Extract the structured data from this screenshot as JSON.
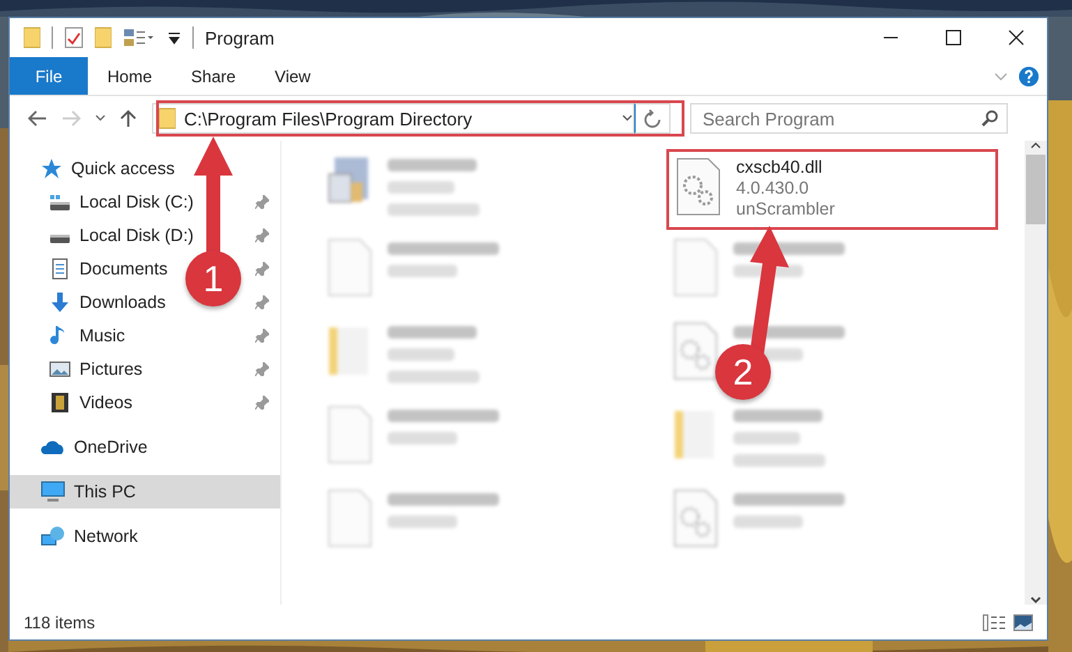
{
  "window": {
    "title": "Program"
  },
  "ribbon": {
    "file_tab": "File",
    "tabs": [
      "Home",
      "Share",
      "View"
    ]
  },
  "address_bar": {
    "path": "C:\\Program Files\\Program Directory"
  },
  "search": {
    "placeholder": "Search Program"
  },
  "sidebar": {
    "items": [
      {
        "label": "Quick access",
        "kind": "quick",
        "selected": false,
        "children": [
          {
            "label": "Local Disk (C:)",
            "kind": "disk-c",
            "pinned": true
          },
          {
            "label": "Local Disk (D:)",
            "kind": "disk",
            "pinned": true
          },
          {
            "label": "Documents",
            "kind": "documents",
            "pinned": true
          },
          {
            "label": "Downloads",
            "kind": "downloads",
            "pinned": true
          },
          {
            "label": "Music",
            "kind": "music",
            "pinned": true
          },
          {
            "label": "Pictures",
            "kind": "pictures",
            "pinned": true
          },
          {
            "label": "Videos",
            "kind": "videos",
            "pinned": true
          }
        ]
      },
      {
        "label": "OneDrive",
        "kind": "cloud",
        "selected": false
      },
      {
        "label": "This PC",
        "kind": "pc",
        "selected": true
      },
      {
        "label": "Network",
        "kind": "network",
        "selected": false
      }
    ]
  },
  "files": [
    {
      "kind": "app",
      "blurred": true,
      "highlighted": false
    },
    {
      "name": "cxscb40.dll",
      "lines": [
        "4.0.430.0",
        "unScrambler"
      ],
      "kind": "dll",
      "blurred": false,
      "highlighted": true
    },
    {
      "kind": "file",
      "blurred": true,
      "highlighted": false
    },
    {
      "kind": "file",
      "blurred": true,
      "highlighted": false
    },
    {
      "kind": "folder",
      "blurred": true,
      "highlighted": false
    },
    {
      "kind": "dll",
      "blurred": true,
      "highlighted": false
    },
    {
      "kind": "file",
      "blurred": true,
      "highlighted": false
    },
    {
      "kind": "folder",
      "blurred": true,
      "highlighted": false
    },
    {
      "kind": "file",
      "blurred": true,
      "highlighted": false
    },
    {
      "kind": "dll",
      "blurred": true,
      "highlighted": false
    }
  ],
  "status_bar": {
    "item_count": "118 items"
  },
  "callouts": [
    {
      "number": "1"
    },
    {
      "number": "2"
    }
  ]
}
